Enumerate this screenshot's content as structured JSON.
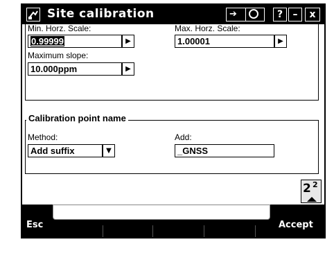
{
  "window": {
    "title": "Site calibration",
    "icons": {
      "app": "tools-icon",
      "switch": "switch-icon",
      "globe": "globe-icon",
      "help": "help-icon",
      "minimize": "minimize-icon",
      "close": "close-icon"
    },
    "help_label": "?",
    "minimize_label": "–",
    "close_label": "x"
  },
  "form": {
    "min_horz_scale": {
      "label": "Min. Horz. Scale:",
      "value": "0.99999"
    },
    "max_horz_scale": {
      "label": "Max. Horz. Scale:",
      "value": "1.00001"
    },
    "max_slope": {
      "label": "Maximum slope:",
      "value": "10.000ppm"
    },
    "calibration_point_name": {
      "group_title": "Calibration point name",
      "method": {
        "label": "Method:",
        "value": "Add suffix"
      },
      "add": {
        "label": "Add:",
        "value": "_GNSS"
      }
    }
  },
  "page_indicator": {
    "current": "2",
    "total": "2"
  },
  "softkeys": {
    "esc": "Esc",
    "accept": "Accept"
  }
}
